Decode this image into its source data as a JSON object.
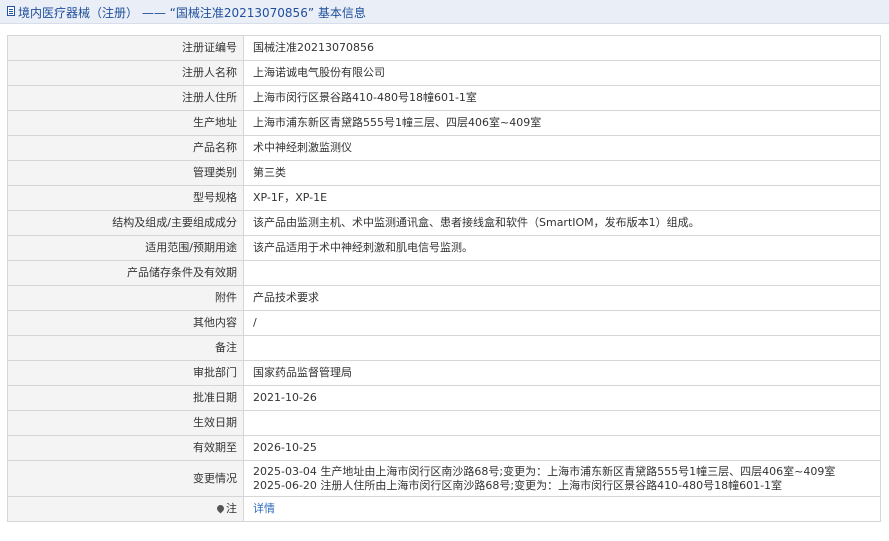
{
  "header": {
    "title": "境内医疗器械（注册） —— “国械注准20213070856” 基本信息"
  },
  "rows": [
    {
      "label": "注册证编号",
      "value": "国械注准20213070856"
    },
    {
      "label": "注册人名称",
      "value": "上海诺诚电气股份有限公司"
    },
    {
      "label": "注册人住所",
      "value": "上海市闵行区景谷路410-480号18幢601-1室"
    },
    {
      "label": "生产地址",
      "value": "上海市浦东新区青黛路555号1幢三层、四层406室~409室"
    },
    {
      "label": "产品名称",
      "value": "术中神经刺激监测仪"
    },
    {
      "label": "管理类别",
      "value": "第三类"
    },
    {
      "label": "型号规格",
      "value": "XP-1F，XP-1E"
    },
    {
      "label": "结构及组成/主要组成成分",
      "value": "该产品由监测主机、术中监测通讯盒、患者接线盒和软件（SmartIOM，发布版本1）组成。"
    },
    {
      "label": "适用范围/预期用途",
      "value": "该产品适用于术中神经刺激和肌电信号监测。"
    },
    {
      "label": "产品储存条件及有效期",
      "value": ""
    },
    {
      "label": "附件",
      "value": "产品技术要求"
    },
    {
      "label": "其他内容",
      "value": "/"
    },
    {
      "label": "备注",
      "value": ""
    },
    {
      "label": "审批部门",
      "value": "国家药品监督管理局"
    },
    {
      "label": "批准日期",
      "value": "2021-10-26"
    },
    {
      "label": "生效日期",
      "value": ""
    },
    {
      "label": "有效期至",
      "value": "2026-10-25"
    }
  ],
  "change_row": {
    "label": "变更情况",
    "lines": [
      "2025-03-04 生产地址由上海市闵行区南沙路68号;变更为：上海市浦东新区青黛路555号1幢三层、四层406室~409室",
      "2025-06-20 注册人住所由上海市闵行区南沙路68号;变更为：上海市闵行区景谷路410-480号18幢601-1室"
    ]
  },
  "note_row": {
    "label": "注",
    "link": "详情"
  },
  "icons": {
    "title_icon": "document-icon",
    "note_icon": "pin-icon"
  },
  "colors": {
    "title_text": "#1f4e9c",
    "link": "#2a6ab8",
    "label_bg": "#f4f4f4"
  }
}
